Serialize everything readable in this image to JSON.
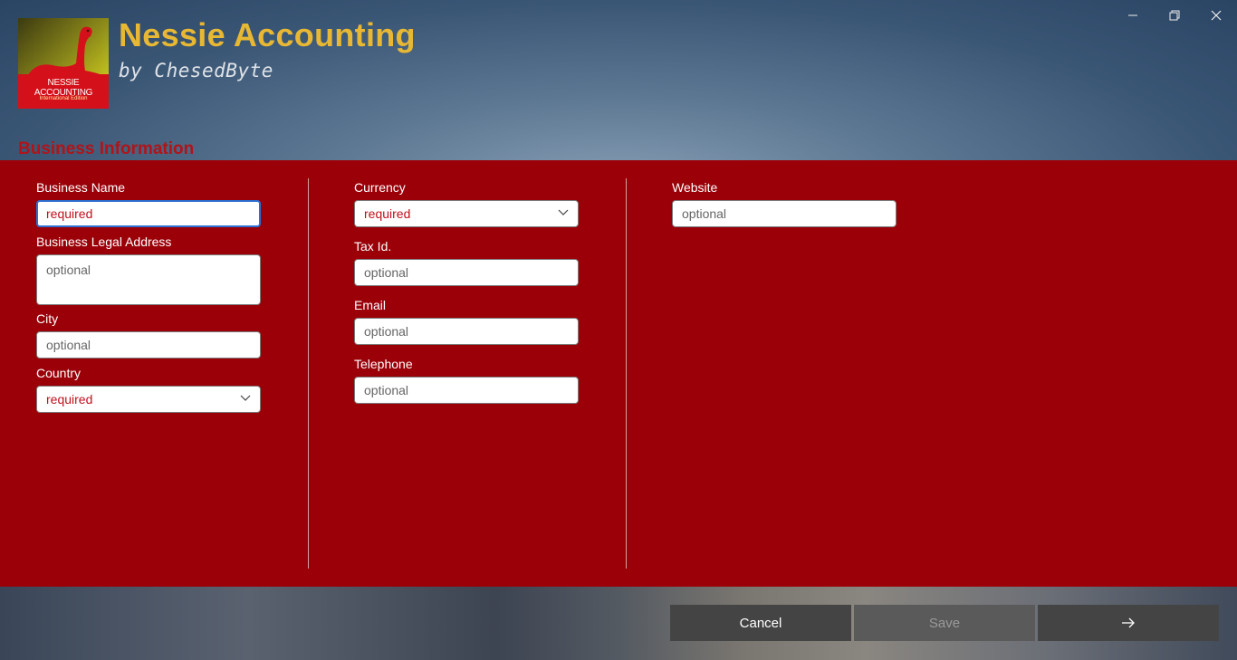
{
  "app": {
    "title": "Nessie Accounting",
    "subtitle": "by ChesedByte",
    "logo_text": "NESSIE ACCOUNTING",
    "logo_subtext": "International Edition"
  },
  "window_controls": {
    "minimize_icon": "minimize-icon",
    "restore_icon": "restore-icon",
    "close_icon": "close-icon"
  },
  "section": {
    "title": "Business Information"
  },
  "form": {
    "business_name": {
      "label": "Business Name",
      "placeholder": "required"
    },
    "business_legal_address": {
      "label": "Business Legal Address",
      "placeholder": "optional"
    },
    "city": {
      "label": "City",
      "placeholder": "optional"
    },
    "country": {
      "label": "Country",
      "value": "required"
    },
    "currency": {
      "label": "Currency",
      "value": "required"
    },
    "tax_id": {
      "label": "Tax Id.",
      "placeholder": "optional"
    },
    "email": {
      "label": "Email",
      "placeholder": "optional"
    },
    "telephone": {
      "label": "Telephone",
      "placeholder": "optional"
    },
    "website": {
      "label": "Website",
      "placeholder": "optional"
    }
  },
  "footer": {
    "cancel_label": "Cancel",
    "save_label": "Save",
    "next_icon": "arrow-right-icon"
  },
  "colors": {
    "panel": "#9b0008",
    "title": "#e8b834",
    "section_title": "#b0141a",
    "required_text": "#c0101a"
  }
}
